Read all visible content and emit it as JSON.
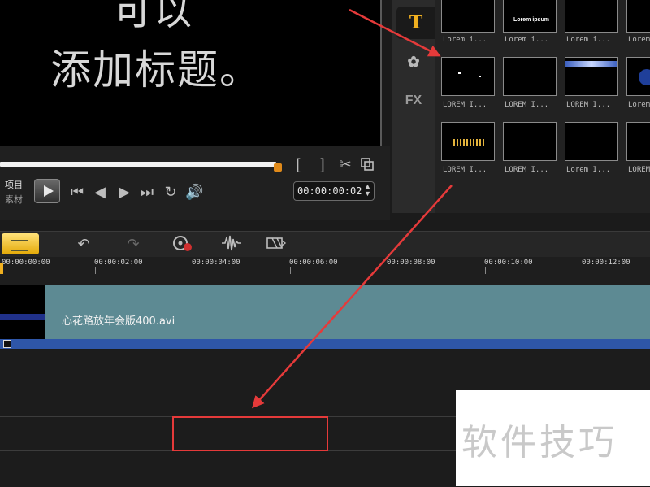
{
  "preview": {
    "line1": "可以",
    "line2": "添加标题。"
  },
  "player": {
    "mode_project": "项目",
    "mode_clip": "素材",
    "mark_in": "[",
    "mark_out": "]",
    "timecode": "00:00:00:02"
  },
  "library": {
    "tabs": [
      {
        "name": "title",
        "icon": "T"
      },
      {
        "name": "graphics",
        "icon": "✿"
      },
      {
        "name": "fx",
        "icon": "FX"
      }
    ],
    "thumbnails": [
      {
        "label": "Lorem i..."
      },
      {
        "label": "Lorem i..."
      },
      {
        "label": "Lorem i..."
      },
      {
        "label": "Lorem"
      },
      {
        "label": "LOREM I..."
      },
      {
        "label": "LOREM I..."
      },
      {
        "label": "LOREM I..."
      },
      {
        "label": "Lorem"
      },
      {
        "label": "LOREM I..."
      },
      {
        "label": "LOREM I..."
      },
      {
        "label": "Lorem I..."
      },
      {
        "label": "LOREM"
      }
    ],
    "thumb_caption": "Lorem ipsum"
  },
  "ruler": {
    "ticks": [
      "00:00:00:00",
      "00:00:02:00",
      "00:00:04:00",
      "00:00:06:00",
      "00:00:08:00",
      "00:00:10:00",
      "00:00:12:00"
    ]
  },
  "timeline": {
    "clip_name": "心花路放年会版400.avi"
  },
  "watermark": {
    "text": "软件技巧"
  },
  "colors": {
    "accent": "#e08a1a",
    "highlight": "#e53a3a",
    "clip": "#5d8a93",
    "audio": "#2e56a8"
  }
}
